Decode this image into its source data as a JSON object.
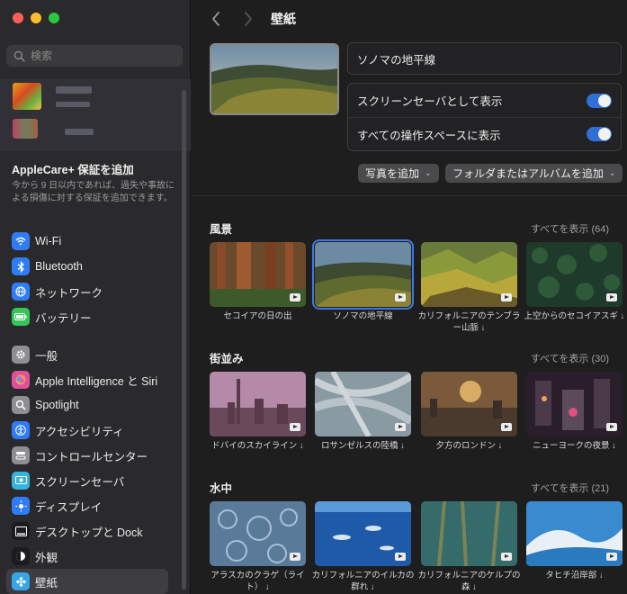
{
  "sidebar": {
    "search_placeholder": "検索",
    "applecare": {
      "title": "AppleCare+ 保証を追加",
      "desc": "今から 9 日以内であれば、過失や事故による損傷に対する保証を追加できます。"
    },
    "group1": [
      {
        "label": "Wi-Fi",
        "icon": "wifi-icon",
        "color": "#2f7cf6"
      },
      {
        "label": "Bluetooth",
        "icon": "bluetooth-icon",
        "color": "#2f7cf6"
      },
      {
        "label": "ネットワーク",
        "icon": "globe-icon",
        "color": "#2f7cf6"
      },
      {
        "label": "バッテリー",
        "icon": "battery-icon",
        "color": "#33c759"
      }
    ],
    "group2": [
      {
        "label": "一般",
        "icon": "gear-icon",
        "color": "#8e8e93"
      },
      {
        "label": "Apple Intelligence と Siri",
        "icon": "siri-icon",
        "color": "#e0509a"
      },
      {
        "label": "Spotlight",
        "icon": "magnifier-icon",
        "color": "#8e8e93"
      },
      {
        "label": "アクセシビリティ",
        "icon": "accessibility-icon",
        "color": "#2f7cf6"
      },
      {
        "label": "コントロールセンター",
        "icon": "control-center-icon",
        "color": "#8e8e93"
      },
      {
        "label": "スクリーンセーバ",
        "icon": "screensaver-icon",
        "color": "#36b3e0"
      },
      {
        "label": "ディスプレイ",
        "icon": "sun-icon",
        "color": "#2f7cf6"
      },
      {
        "label": "デスクトップと Dock",
        "icon": "dock-icon",
        "color": "#1c1c1e"
      },
      {
        "label": "外観",
        "icon": "appearance-icon",
        "color": "#1c1c1e"
      },
      {
        "label": "壁紙",
        "icon": "wallpaper-icon",
        "color": "#36a6e8"
      }
    ],
    "active": "壁紙"
  },
  "main": {
    "title": "壁紙",
    "current_name": "ソノマの地平線",
    "options": [
      {
        "label": "スクリーンセーバとして表示",
        "on": true
      },
      {
        "label": "すべての操作スペースに表示",
        "on": true
      }
    ],
    "add_photo": "写真を追加",
    "add_folder": "フォルダまたはアルバムを追加",
    "sections": [
      {
        "title": "風景",
        "show_all": "すべてを表示 (64)",
        "items": [
          {
            "cap": "セコイアの日の出"
          },
          {
            "cap": "ソノマの地平線",
            "selected": true
          },
          {
            "cap": "カリフォルニアのテンブラー山脈 ↓"
          },
          {
            "cap": "上空からのセコイアスギ ↓"
          }
        ]
      },
      {
        "title": "街並み",
        "show_all": "すべてを表示 (30)",
        "items": [
          {
            "cap": "ドバイのスカイライン ↓"
          },
          {
            "cap": "ロサンゼルスの陸橋 ↓"
          },
          {
            "cap": "夕方のロンドン ↓"
          },
          {
            "cap": "ニューヨークの夜景 ↓"
          }
        ]
      },
      {
        "title": "水中",
        "show_all": "すべてを表示 (21)",
        "items": [
          {
            "cap": "アラスカのクラゲ（ライト） ↓"
          },
          {
            "cap": "カリフォルニアのイルカの群れ ↓"
          },
          {
            "cap": "カリフォルニアのケルプの森 ↓"
          },
          {
            "cap": "タヒチ沿岸部 ↓"
          }
        ]
      }
    ]
  }
}
